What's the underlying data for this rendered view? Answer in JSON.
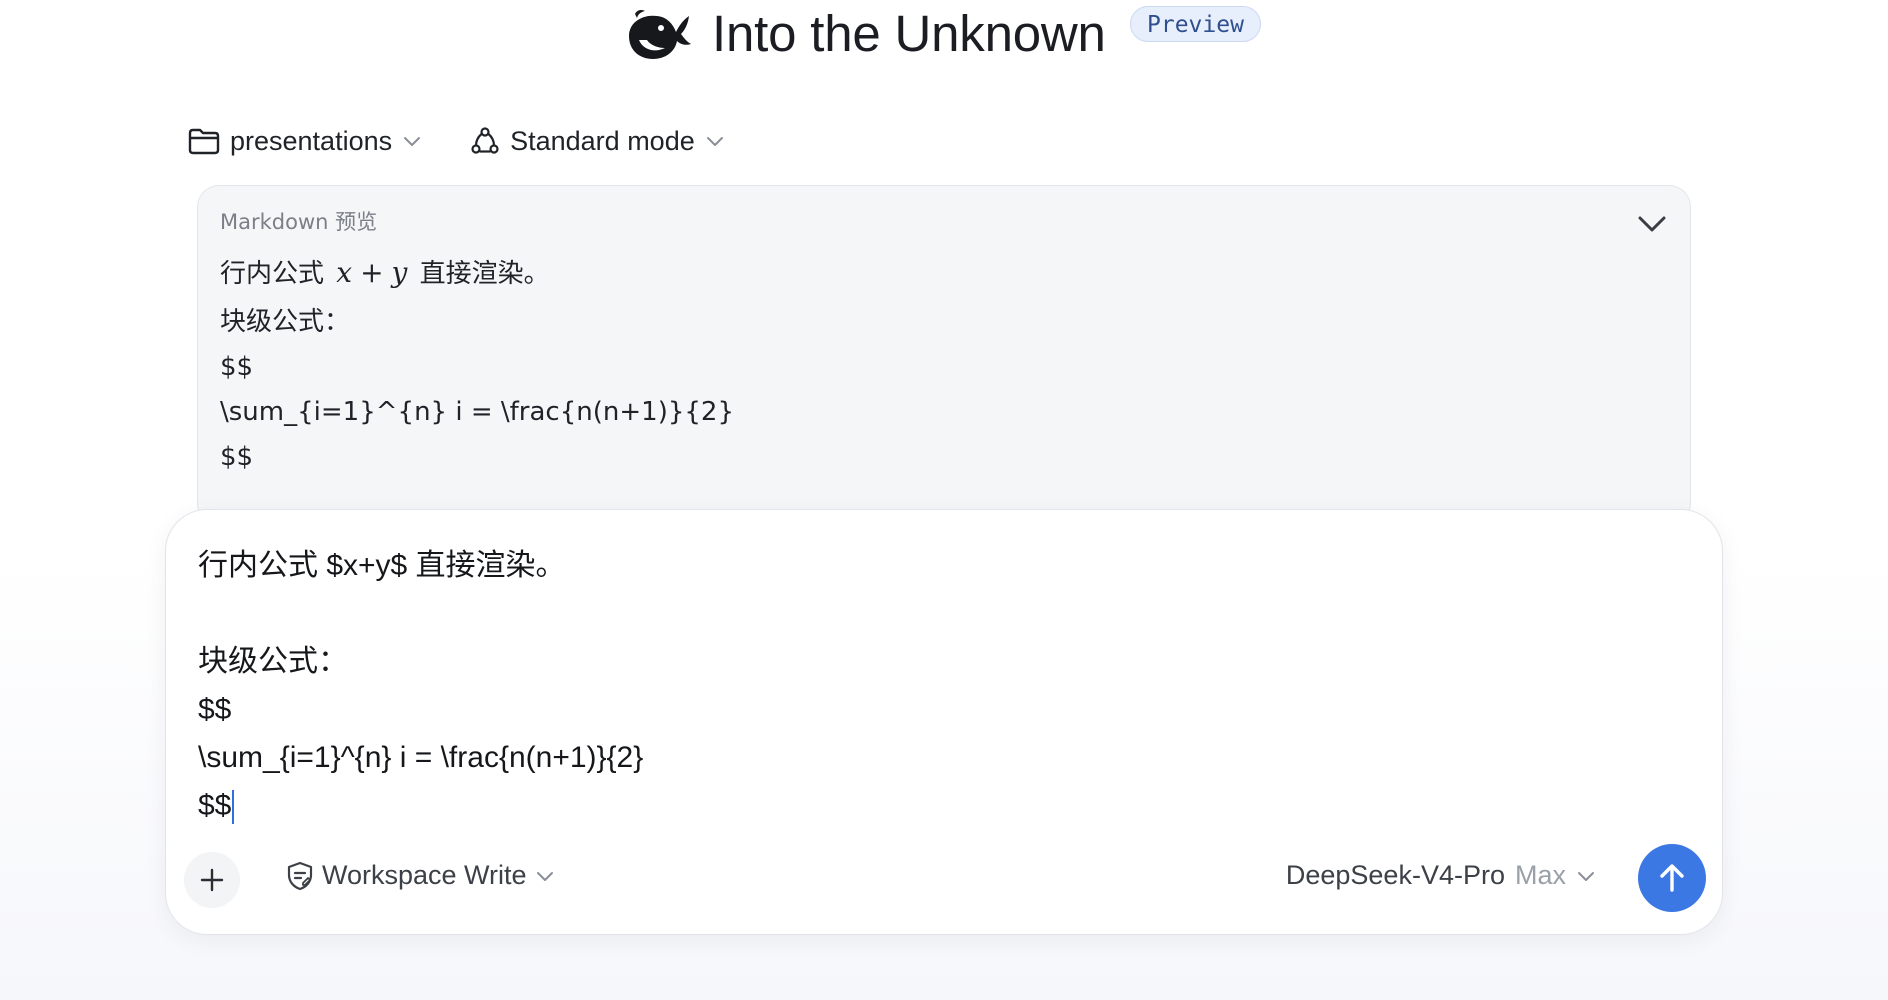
{
  "header": {
    "title": "Into the Unknown",
    "badge": "Preview"
  },
  "toolbar": {
    "folder_label": "presentations",
    "mode_label": "Standard mode"
  },
  "preview": {
    "label": "Markdown 预览",
    "inline_before": "行内公式",
    "inline_math_x": "x",
    "inline_math_op": "+",
    "inline_math_y": "y",
    "inline_after": "直接渲染。",
    "lines": [
      "块级公式：",
      "$$",
      "\\sum_{i=1}^{n} i = \\frac{n(n+1)}{2}",
      "$$"
    ]
  },
  "composer": {
    "lines": [
      "行内公式 $x+y$ 直接渲染。",
      "",
      "块级公式：",
      "$$",
      "\\sum_{i=1}^{n} i = \\frac{n(n+1)}{2}",
      "$$"
    ],
    "permission_label": "Workspace Write",
    "model_name": "DeepSeek-V4-Pro",
    "model_tier": "Max"
  },
  "colors": {
    "accent": "#3b78e3",
    "badge_bg": "#e8effc",
    "panel_bg": "#f5f6f8",
    "caret": "#2f6fde"
  },
  "icons": {
    "logo": "whale-logo-icon",
    "folder": "folder-icon",
    "mode": "nodes-cycle-icon",
    "collapse": "chevron-down-icon",
    "attach": "plus-icon",
    "permission": "shield-edit-icon",
    "send": "arrow-up-icon"
  }
}
